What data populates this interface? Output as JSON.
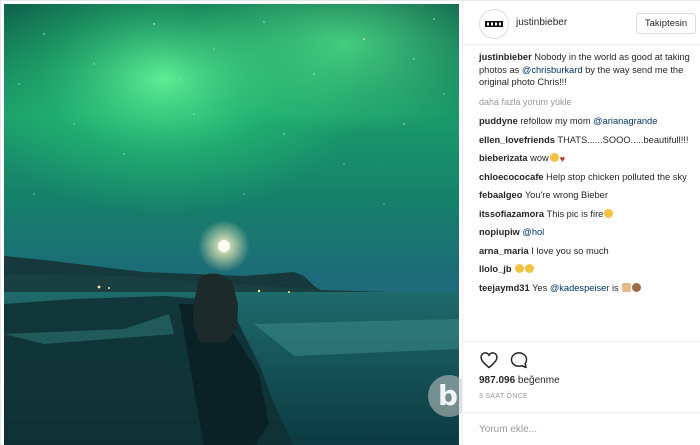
{
  "post": {
    "author": "justinbieber",
    "follow_label": "Takiptesin",
    "caption_user": "justinbieber",
    "caption_text_1": " Nobody in the world as good at taking photos as ",
    "caption_mention": "@chrisburkard",
    "caption_text_2": " by the way send me the original photo Chris!!!",
    "more_comments": "daha fazla yorum yükle"
  },
  "comments": [
    {
      "user": "puddyne",
      "text": " refollow my mom ",
      "mention": "@arianagrande"
    },
    {
      "user": "ellen_lovefriends",
      "text": " THATS......SOOO.....beautifull!!!"
    },
    {
      "user": "bieberizata",
      "text": " wow"
    },
    {
      "user": "chloecococafe",
      "text": " Help stop chicken polluted the sky"
    },
    {
      "user": "febaalgeo",
      "text": " You're wrong Bieber"
    },
    {
      "user": "itssofiazamora",
      "text": " This pic is fire"
    },
    {
      "user": "nopiupiw",
      "text": " ",
      "mention": "@hol"
    },
    {
      "user": "arna_maria",
      "text": " I love you so much"
    },
    {
      "user": "llolo_jb",
      "text": " "
    },
    {
      "user": "teejaymd31",
      "text": " Yes ",
      "mention": "@kadespeiser"
    }
  ],
  "actions": {
    "like_icon": "heart-icon",
    "comment_icon": "comment-icon",
    "likes_count": "987.096",
    "likes_label": " beğenme",
    "time_ago": "3 SAAT ÖNCE",
    "add_comment_placeholder": "Yorum ekle..."
  },
  "colors": {
    "accent_link": "#003569",
    "muted": "#999999",
    "aurora": "#3ddc84",
    "sky": "#0f3f52"
  }
}
